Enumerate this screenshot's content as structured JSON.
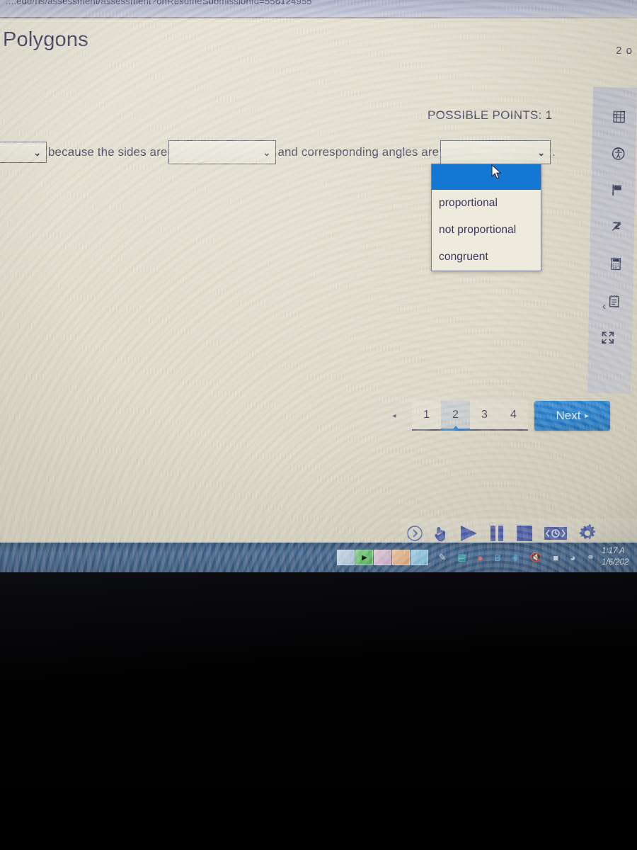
{
  "browser": {
    "url_fragment": "....edu/hs/assessment/assessment?onResumeSubmissionId=556124955"
  },
  "page": {
    "title": "Polygons",
    "progress_counter": "2 o",
    "possible_points": "POSSIBLE POINTS: 1"
  },
  "question": {
    "select_1_value": "",
    "text_1": "because the sides are",
    "select_2_value": "",
    "text_2": "and corresponding angles are",
    "select_3_value": "",
    "period": "."
  },
  "dropdown": {
    "open": true,
    "options": [
      {
        "label": "",
        "selected": true
      },
      {
        "label": "proportional",
        "selected": false
      },
      {
        "label": "not proportional",
        "selected": false
      },
      {
        "label": "congruent",
        "selected": false
      }
    ]
  },
  "pagination": {
    "prev_label": "◂",
    "pages": [
      "1",
      "2",
      "3",
      "4"
    ],
    "active_page": "2",
    "next_label": "Next",
    "next_arrow": "▸"
  },
  "tool_rail": {
    "icons": [
      "calculator-grid-icon",
      "accessibility-icon",
      "flag-icon",
      "annotate-pencil-icon",
      "calculator-icon",
      "notepad-icon",
      "fullscreen-expand-icon"
    ],
    "collapse_label": "‹"
  },
  "media_bar": {
    "buttons": [
      "expand-circle-icon",
      "hand-pointer-icon",
      "play-icon",
      "pause-icon",
      "stop-icon",
      "rewind-icon",
      "settings-gear-icon"
    ]
  },
  "taskbar": {
    "apps": [
      "photo-app-icon",
      "media-player-icon",
      "store-icon",
      "paint-icon",
      "browser-icon"
    ],
    "tray": [
      "pen-icon",
      "monitor-icon",
      "defender-icon",
      "bluetooth-icon",
      "dropbox-icon",
      "volume-muted-icon",
      "battery-icon",
      "wifi-icon",
      "network-icon"
    ],
    "clock_time": "1:17 A",
    "clock_date": "1/6/202"
  },
  "colors": {
    "accent_blue": "#1477d4",
    "page_bg": "#ded9c7",
    "text": "#3c3a5a",
    "taskbar": "#3a5f8d"
  }
}
